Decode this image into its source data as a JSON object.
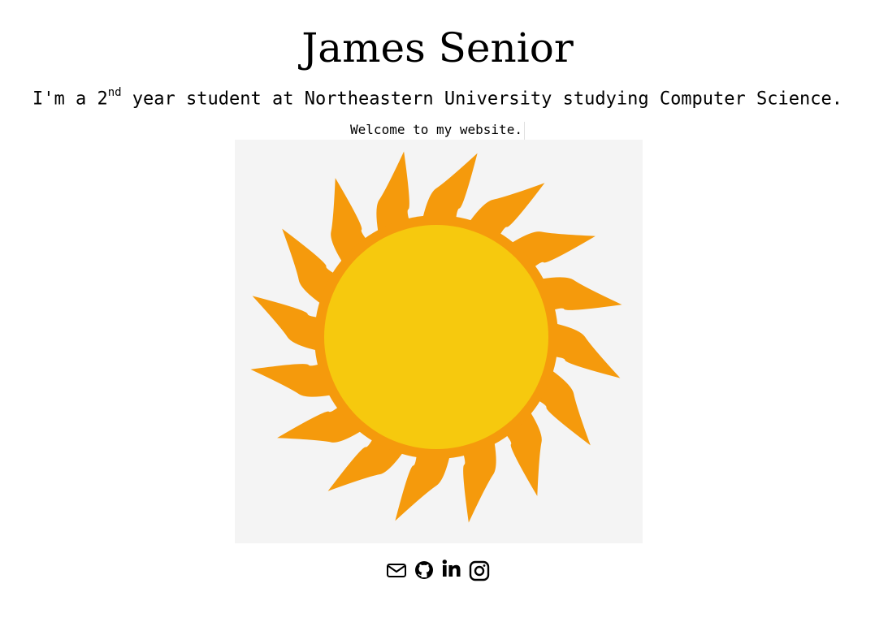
{
  "header": {
    "name": "James Senior",
    "intro_prefix": "I'm a 2",
    "intro_ordinal": "nd",
    "intro_suffix": " year student at Northeastern University studying Computer Science.",
    "welcome": "Welcome to my website."
  },
  "hero": {
    "image_subject": "sun",
    "background_color": "#f4f4f4",
    "sun_core_color": "#f6c90e",
    "sun_ray_color": "#f59a0c"
  },
  "social": {
    "links": [
      {
        "icon": "envelope-icon",
        "name": "email-link"
      },
      {
        "icon": "github-icon",
        "name": "github-link"
      },
      {
        "icon": "linkedin-icon",
        "name": "linkedin-link"
      },
      {
        "icon": "instagram-icon",
        "name": "instagram-link"
      }
    ]
  }
}
